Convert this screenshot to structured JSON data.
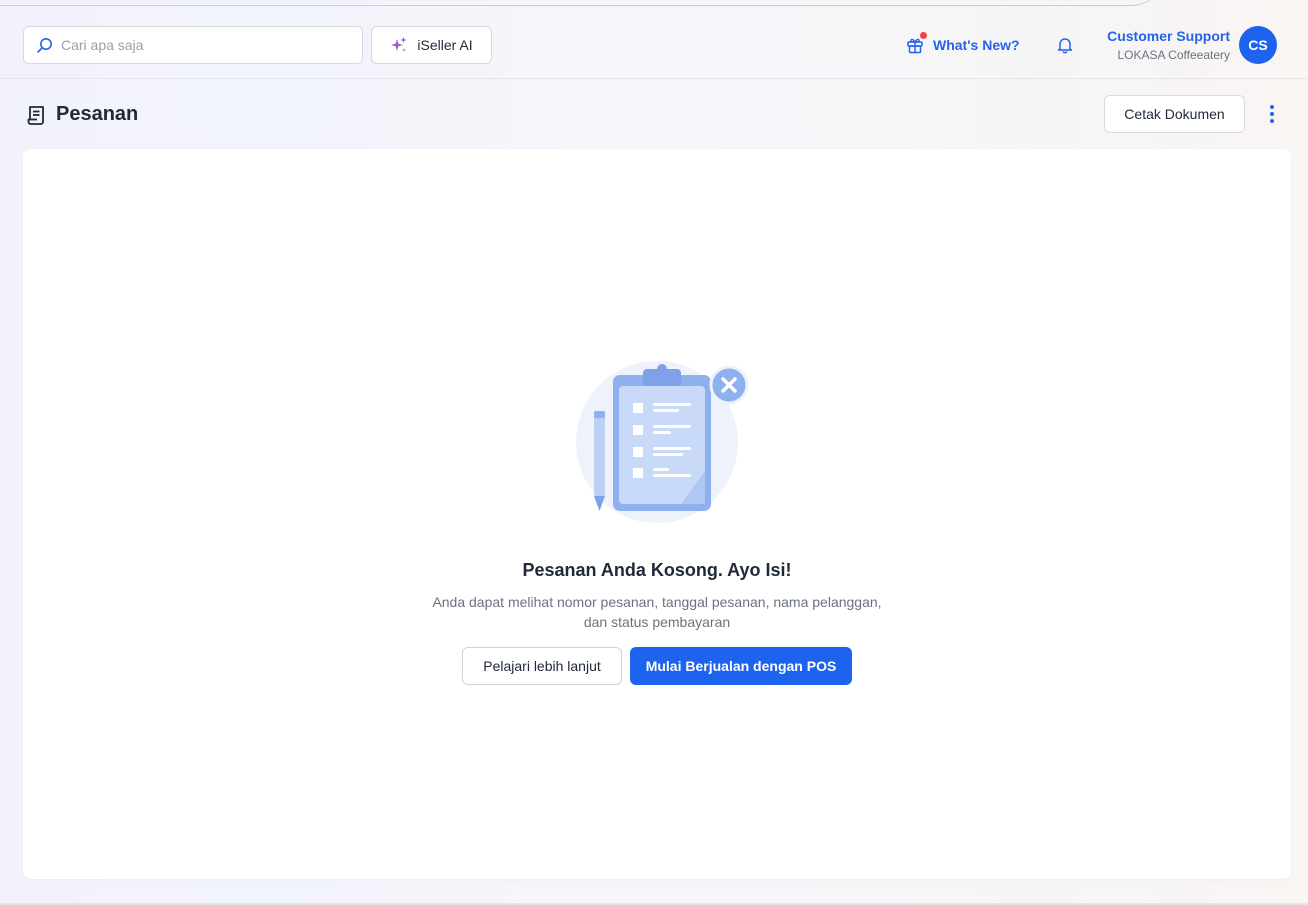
{
  "header": {
    "search_placeholder": "Cari apa saja",
    "ai_button_label": "iSeller AI",
    "whats_new_label": "What's New?",
    "user_name": "Customer Support",
    "store_name": "LOKASA Coffeeatery",
    "avatar_initials": "CS",
    "icons": {
      "search": "search-icon",
      "ai": "sparkle-icon",
      "whats_new": "gift-icon",
      "notifications": "bell-icon"
    }
  },
  "page": {
    "title": "Pesanan",
    "title_icon": "receipt-icon",
    "print_button_label": "Cetak Dokumen",
    "more_icon": "more-vertical-icon"
  },
  "empty_state": {
    "illustration": "empty-clipboard-illustration",
    "title": "Pesanan Anda Kosong. Ayo Isi!",
    "description_line1": "Anda dapat melihat nomor pesanan, tanggal pesanan, nama pelanggan,",
    "description_line2": "dan status pembayaran",
    "learn_more_label": "Pelajari lebih lanjut",
    "start_pos_label": "Mulai Berjualan dengan POS"
  },
  "colors": {
    "primary": "#1d63ed",
    "link": "#2563eb",
    "notification_dot": "#ef4444"
  }
}
